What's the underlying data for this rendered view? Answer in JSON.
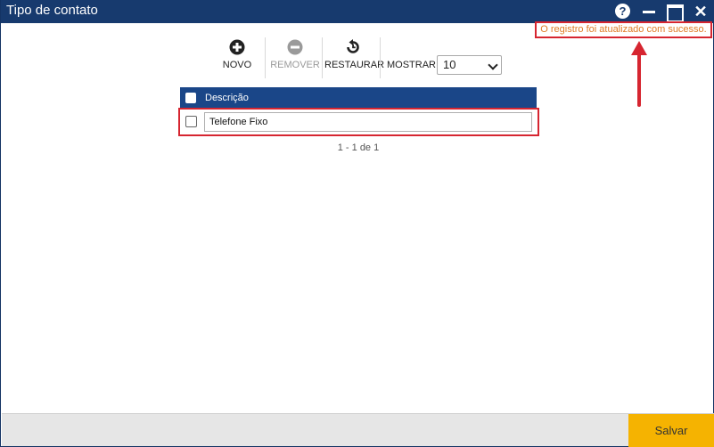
{
  "window": {
    "title": "Tipo de contato",
    "help_glyph": "?",
    "close_glyph": "✕"
  },
  "status": {
    "message": "O registro foi atualizado com sucesso."
  },
  "toolbar": {
    "new_label": "NOVO",
    "remove_label": "REMOVER",
    "restore_label": "RESTAURAR",
    "show_label": "MOSTRAR:",
    "show_value": "10"
  },
  "grid": {
    "header": "Descrição",
    "rows": [
      {
        "descricao": "Telefone Fixo"
      }
    ],
    "pager": "1 - 1 de 1"
  },
  "footer": {
    "save_label": "Salvar"
  },
  "colors": {
    "titlebar": "#173a6e",
    "grid_header": "#1a4688",
    "highlight": "#d62530",
    "status_text": "#e07b25",
    "save_button": "#f5b301"
  },
  "icons": {
    "new": "plus-circle-icon",
    "remove": "minus-circle-icon",
    "restore": "restore-icon",
    "help": "help-icon",
    "minimize": "minimize-icon",
    "maximize": "maximize-icon",
    "close": "close-icon"
  }
}
